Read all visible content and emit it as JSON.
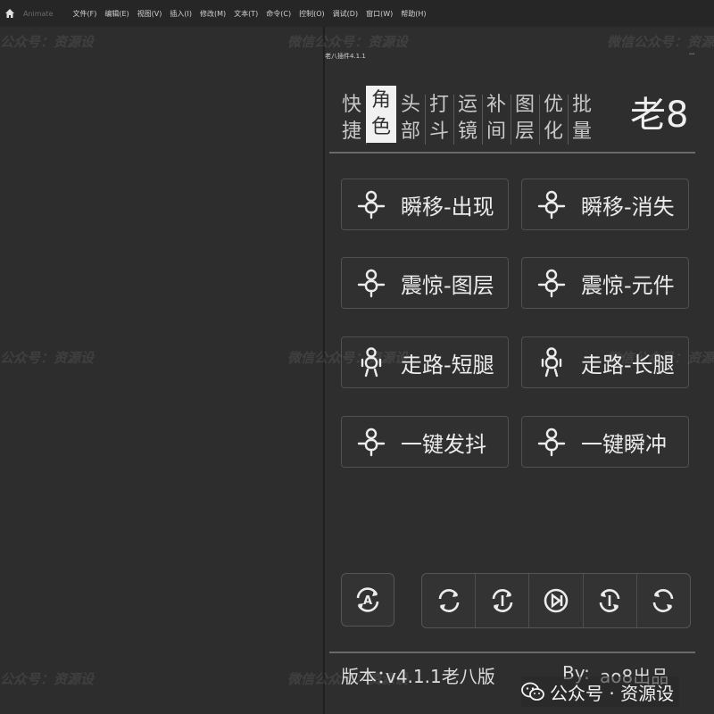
{
  "menubar": {
    "app_name": "Animate",
    "items": [
      "文件(F)",
      "编辑(E)",
      "视图(V)",
      "插入(I)",
      "修改(M)",
      "文本(T)",
      "命令(C)",
      "控制(O)",
      "调试(D)",
      "窗口(W)",
      "帮助(H)"
    ]
  },
  "panel": {
    "title": "老八插件4.1.1",
    "menu_glyph": "···",
    "tabs": [
      {
        "top": "快",
        "bottom": "捷"
      },
      {
        "top": "角",
        "bottom": "色"
      },
      {
        "top": "头",
        "bottom": "部"
      },
      {
        "top": "打",
        "bottom": "斗"
      },
      {
        "top": "运",
        "bottom": "镜"
      },
      {
        "top": "补",
        "bottom": "间"
      },
      {
        "top": "图",
        "bottom": "层"
      },
      {
        "top": "优",
        "bottom": "化"
      },
      {
        "top": "批",
        "bottom": "量"
      }
    ],
    "active_tab": 1,
    "logo": "老8",
    "actions": [
      {
        "label": "瞬移-出现",
        "icon": "figure-icon"
      },
      {
        "label": "瞬移-消失",
        "icon": "figure-icon"
      },
      {
        "label": "震惊-图层",
        "icon": "figure-icon"
      },
      {
        "label": "震惊-元件",
        "icon": "figure-icon"
      },
      {
        "label": "走路-短腿",
        "icon": "walking-figure-icon"
      },
      {
        "label": "走路-长腿",
        "icon": "walking-figure-icon"
      },
      {
        "label": "一键发抖",
        "icon": "figure-icon"
      },
      {
        "label": "一键瞬冲",
        "icon": "figure-icon"
      }
    ],
    "footer": {
      "version_label": "版本：",
      "version_value": "v4.1.1老八版",
      "by_label": "By:",
      "by_value": "ao8出品"
    }
  },
  "watermarks": {
    "text_a": "公众号：资源设",
    "text_b": "微信公众号：资源设",
    "badge": "公众号 · 资源设"
  },
  "colors": {
    "background": "#2b2b2b",
    "panel": "#2e2e2e",
    "active_tab": "#f1f1f1",
    "text": "#e8e8e8"
  }
}
